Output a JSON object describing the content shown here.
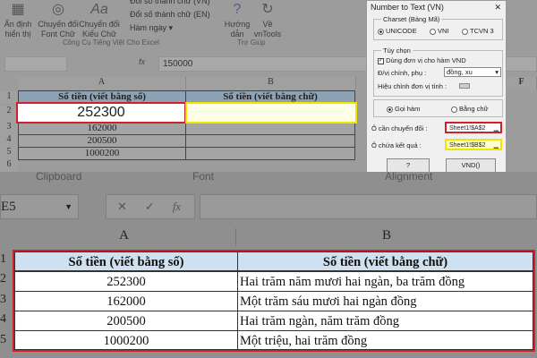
{
  "top": {
    "ribbon": {
      "buttons": [
        {
          "label1": "Ẩn định",
          "label2": "hiển thị",
          "icon": "excel-grid-icon"
        },
        {
          "label1": "Chuyển đổi",
          "label2": "Font Chữ",
          "icon": "check-circle-icon"
        },
        {
          "label1": "Chuyển đổi",
          "label2": "Kiểu Chữ",
          "icon": "font-aa-icon"
        }
      ],
      "list": [
        "Đổi số thành chữ (VN)",
        "Đổi số thành chữ (EN)",
        "Hàm ngày ▾"
      ],
      "help": [
        {
          "label1": "Hướng",
          "label2": "dẫn",
          "icon": "question-icon"
        },
        {
          "label1": "Về",
          "label2": "vnTools",
          "icon": "refresh-icon"
        }
      ],
      "groups": [
        "Công Cụ Tiếng Việt Cho Excel",
        "Trợ Giúp"
      ]
    },
    "formula_bar": {
      "name_box": "",
      "value": "150000",
      "fx": "fx"
    },
    "columns": [
      "A",
      "B",
      "F"
    ],
    "rows": [
      "1",
      "2",
      "3",
      "4",
      "5",
      "6"
    ],
    "table": {
      "headers": [
        "Số tiền (viết bằng số)",
        "Số tiền (viết bằng chữ)"
      ],
      "values": [
        "252300",
        "162000",
        "200500",
        "1000200"
      ]
    },
    "dialog": {
      "title": "Number to Text (VN)",
      "close": "✕",
      "charset_legend": "Charset (Bảng Mã)",
      "charsets": [
        "UNICODE",
        "VNI",
        "TCVN 3"
      ],
      "charset_selected": "UNICODE",
      "options_legend": "Tùy chọn",
      "use_vnd_label": "Dùng đơn vị cho hàm VND",
      "use_vnd_checked": true,
      "unit_label": "Đ/vị chính, phụ :",
      "unit_value": "đồng, xu",
      "unit_adjust_label": "Hiệu chỉnh đơn vị tính :",
      "modes": [
        "Gọi hàm",
        "Bằng chữ"
      ],
      "mode_selected": "Gọi hàm",
      "source_label": "Ô cần chuyển đổi :",
      "source_value": "Sheet1!$A$2",
      "result_label": "Ô chứa kết quả :",
      "result_value": "Sheet1!$B$2",
      "help_button": "?",
      "vnd_button": "VND()",
      "highlight_source": "#d0202a",
      "highlight_result": "#f2e600"
    }
  },
  "bottom": {
    "ribbon_groups": [
      "Clipboard",
      "Font",
      "Alignment"
    ],
    "formula_bar": {
      "name_box": "E5",
      "fx": "fx",
      "value": ""
    },
    "columns": [
      "A",
      "B"
    ],
    "rows": [
      "1",
      "2",
      "3",
      "4",
      "5"
    ],
    "table": {
      "headers": [
        "Số tiền (viết bằng số)",
        "Số tiền (viết bằng chữ)"
      ],
      "rows": [
        [
          "252300",
          "Hai trăm năm mươi hai ngàn, ba trăm đồng"
        ],
        [
          "162000",
          "Một trăm sáu mươi hai ngàn đồng"
        ],
        [
          "200500",
          "Hai trăm ngàn, năm trăm đồng"
        ],
        [
          "1000200",
          "Một triệu, hai trăm đồng"
        ]
      ]
    },
    "header_color": "#cfe0f1",
    "highlight_border": "#d0202a"
  }
}
